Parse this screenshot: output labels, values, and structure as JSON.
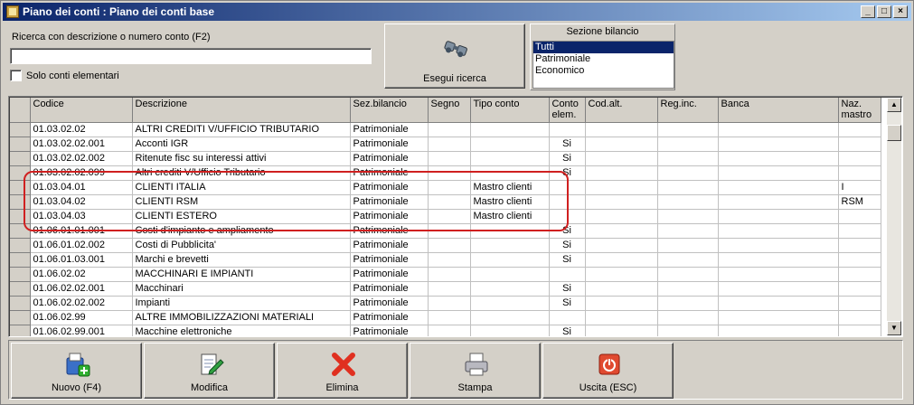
{
  "window": {
    "title": "Piano dei conti : Piano dei conti base"
  },
  "search": {
    "label": "Ricerca con descrizione o numero conto (F2)",
    "value": "",
    "checkbox_label": "Solo conti elementari",
    "button_label": "Esegui ricerca"
  },
  "sezione": {
    "title": "Sezione bilancio",
    "options": [
      "Tutti",
      "Patrimoniale",
      "Economico"
    ],
    "selected": "Tutti"
  },
  "grid": {
    "headers": [
      "Codice",
      "Descrizione",
      "Sez.bilancio",
      "Segno",
      "Tipo conto",
      "Conto elem.",
      "Cod.alt.",
      "Reg.inc.",
      "Banca",
      "Naz. mastro"
    ],
    "rows": [
      [
        "01.03.02.02",
        "ALTRI CREDITI V/UFFICIO TRIBUTARIO",
        "Patrimoniale",
        "",
        "",
        "",
        "",
        "",
        "",
        ""
      ],
      [
        "01.03.02.02.001",
        "Acconti IGR",
        "Patrimoniale",
        "",
        "",
        "Si",
        "",
        "",
        "",
        ""
      ],
      [
        "01.03.02.02.002",
        "Ritenute fisc su interessi attivi",
        "Patrimoniale",
        "",
        "",
        "Si",
        "",
        "",
        "",
        ""
      ],
      [
        "01.03.02.02.099",
        "Altri crediti V/Ufficio Tributario",
        "Patrimoniale",
        "",
        "",
        "Si",
        "",
        "",
        "",
        ""
      ],
      [
        "01.03.04.01",
        "CLIENTI ITALIA",
        "Patrimoniale",
        "",
        "Mastro clienti",
        "",
        "",
        "",
        "",
        "I"
      ],
      [
        "01.03.04.02",
        "CLIENTI RSM",
        "Patrimoniale",
        "",
        "Mastro clienti",
        "",
        "",
        "",
        "",
        "RSM"
      ],
      [
        "01.03.04.03",
        "CLIENTI ESTERO",
        "Patrimoniale",
        "",
        "Mastro clienti",
        "",
        "",
        "",
        "",
        ""
      ],
      [
        "01.06.01.01.001",
        "Costi d'impianto e ampliamento",
        "Patrimoniale",
        "",
        "",
        "Si",
        "",
        "",
        "",
        ""
      ],
      [
        "01.06.01.02.002",
        "Costi di Pubblicita'",
        "Patrimoniale",
        "",
        "",
        "Si",
        "",
        "",
        "",
        ""
      ],
      [
        "01.06.01.03.001",
        "Marchi e brevetti",
        "Patrimoniale",
        "",
        "",
        "Si",
        "",
        "",
        "",
        ""
      ],
      [
        "01.06.02.02",
        "MACCHINARI E IMPIANTI",
        "Patrimoniale",
        "",
        "",
        "",
        "",
        "",
        "",
        ""
      ],
      [
        "01.06.02.02.001",
        "Macchinari",
        "Patrimoniale",
        "",
        "",
        "Si",
        "",
        "",
        "",
        ""
      ],
      [
        "01.06.02.02.002",
        "Impianti",
        "Patrimoniale",
        "",
        "",
        "Si",
        "",
        "",
        "",
        ""
      ],
      [
        "01.06.02.99",
        "ALTRE IMMOBILIZZAZIONI MATERIALI",
        "Patrimoniale",
        "",
        "",
        "",
        "",
        "",
        "",
        ""
      ],
      [
        "01.06.02.99.001",
        "Macchine elettroniche",
        "Patrimoniale",
        "",
        "",
        "Si",
        "",
        "",
        "",
        ""
      ]
    ]
  },
  "toolbar": {
    "new_label": "Nuovo (F4)",
    "edit_label": "Modifica",
    "delete_label": "Elimina",
    "print_label": "Stampa",
    "exit_label": "Uscita (ESC)"
  },
  "colors": {
    "highlight": "#d02020",
    "titlebar": "#0a246a",
    "selection": "#0a246a"
  }
}
